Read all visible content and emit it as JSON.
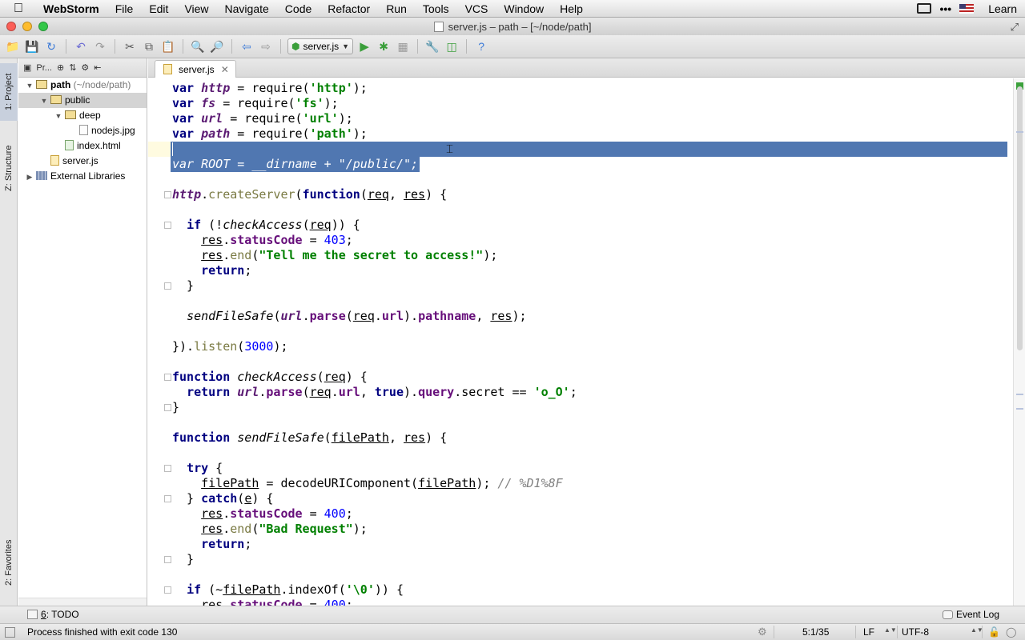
{
  "menubar": {
    "app": "WebStorm",
    "items": [
      "File",
      "Edit",
      "View",
      "Navigate",
      "Code",
      "Refactor",
      "Run",
      "Tools",
      "VCS",
      "Window",
      "Help"
    ],
    "right_label": "Learn"
  },
  "window": {
    "title": "server.js – path – [~/node/path]"
  },
  "toolbar": {
    "run_config": "server.js"
  },
  "side_tabs": {
    "project": "1: Project",
    "structure": "Z: Structure",
    "favorites": "2: Favorites"
  },
  "project": {
    "header": "Pr...",
    "tree": [
      {
        "name": "path",
        "suffix": " (~/node/path)",
        "type": "folder",
        "depth": 0,
        "expanded": true,
        "bold": true
      },
      {
        "name": "public",
        "type": "folder",
        "depth": 1,
        "expanded": true,
        "selected": true
      },
      {
        "name": "deep",
        "type": "folder",
        "depth": 2,
        "expanded": true
      },
      {
        "name": "nodejs.jpg",
        "type": "file",
        "depth": 3
      },
      {
        "name": "index.html",
        "type": "html",
        "depth": 2
      },
      {
        "name": "server.js",
        "type": "js",
        "depth": 1
      },
      {
        "name": "External Libraries",
        "type": "lib",
        "depth": 0,
        "expanded": false
      }
    ]
  },
  "editor": {
    "tab": "server.js",
    "lines": [
      "var http = require('http');",
      "var fs = require('fs');",
      "var url = require('url');",
      "var path = require('path');",
      "",
      "var ROOT = __dirname + \"/public/\";",
      "",
      "http.createServer(function(req, res) {",
      "",
      "  if (!checkAccess(req)) {",
      "    res.statusCode = 403;",
      "    res.end(\"Tell me the secret to access!\");",
      "    return;",
      "  }",
      "",
      "  sendFileSafe(url.parse(req.url).pathname, res);",
      "",
      "}).listen(3000);",
      "",
      "function checkAccess(req) {",
      "  return url.parse(req.url, true).query.secret == 'o_O';",
      "}",
      "",
      "function sendFileSafe(filePath, res) {",
      "",
      "  try {",
      "    filePath = decodeURIComponent(filePath); // %D1%8F",
      "  } catch(e) {",
      "    res.statusCode = 400;",
      "    res.end(\"Bad Request\");",
      "    return;",
      "  }",
      "",
      "  if (~filePath.indexOf('\\0')) {",
      "    res.statusCode = 400;"
    ]
  },
  "bottom_tools": {
    "todo_key": "6",
    "todo_label": ": TODO",
    "event_log": "Event Log"
  },
  "status": {
    "message": "Process finished with exit code 130",
    "position": "5:1/35",
    "line_sep": "LF",
    "encoding": "UTF-8"
  },
  "colors": {
    "selection": "#5077b1",
    "keyword": "#000080",
    "string": "#008000",
    "number": "#0000ff"
  }
}
